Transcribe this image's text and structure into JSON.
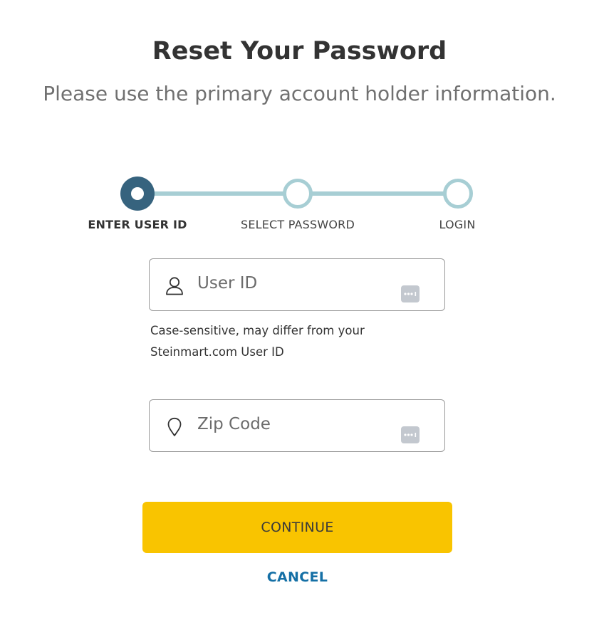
{
  "header": {
    "title": "Reset Your Password",
    "subtitle": "Please use the primary account holder information."
  },
  "stepper": {
    "steps": [
      {
        "label": "ENTER USER ID",
        "state": "active"
      },
      {
        "label": "SELECT PASSWORD",
        "state": "pending"
      },
      {
        "label": "LOGIN",
        "state": "pending"
      }
    ],
    "colors": {
      "active": "#36637e",
      "pending": "#a7ced4"
    }
  },
  "form": {
    "user_id": {
      "placeholder": "User ID",
      "value": "",
      "icon": "user-icon",
      "help_lines": [
        "Case-sensitive, may differ from your",
        "Steinmart.com User ID"
      ]
    },
    "zip_code": {
      "placeholder": "Zip Code",
      "value": "",
      "icon": "location-pin-icon"
    },
    "password_manager_icon": "password-manager-icon"
  },
  "actions": {
    "continue_label": "CONTINUE",
    "cancel_label": "CANCEL",
    "continue_color": "#f9c400",
    "cancel_color": "#1570a6"
  }
}
